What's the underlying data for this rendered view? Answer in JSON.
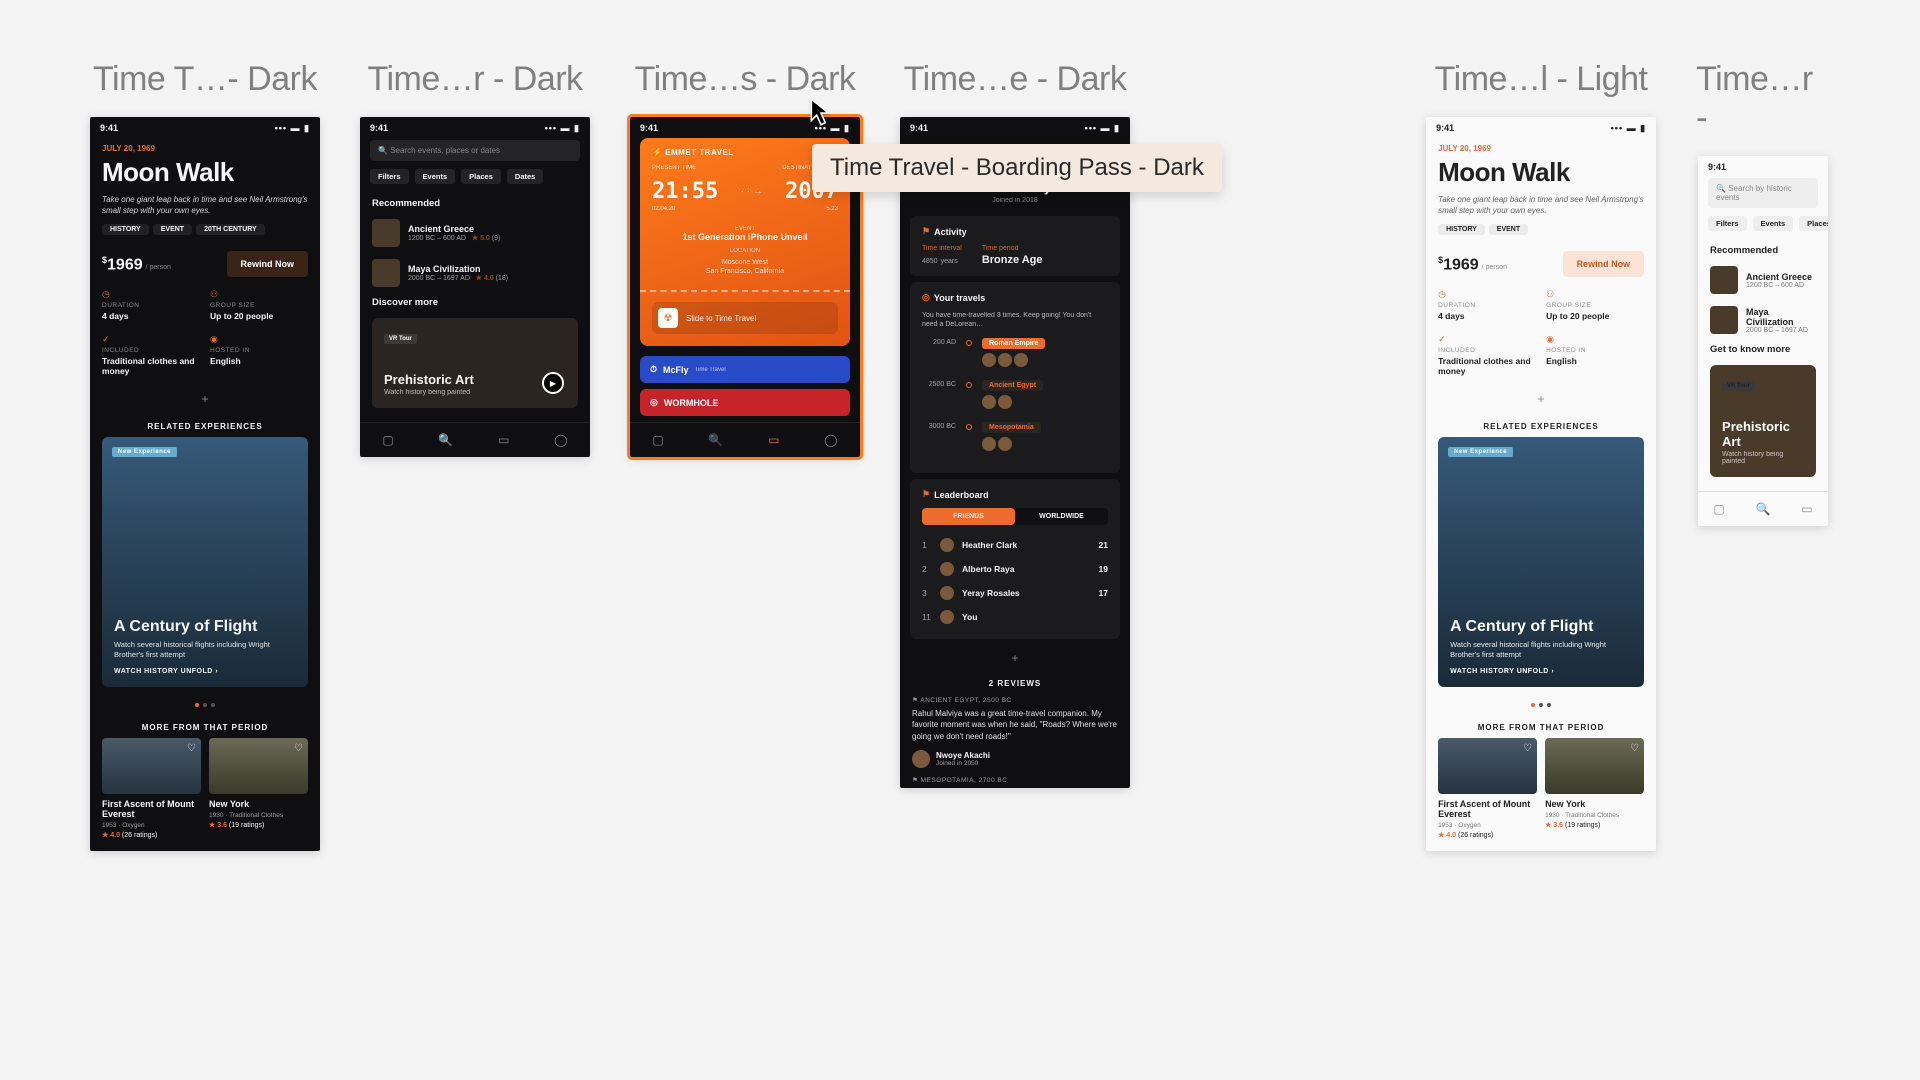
{
  "artboards": {
    "a1": "Time T…- Dark",
    "a2": "Time…r - Dark",
    "a3": "Time…s - Dark",
    "a4": "Time…e - Dark",
    "a5": "Time…l - Light",
    "a6": "Time…r -"
  },
  "tooltip": "Time Travel - Boarding Pass - Dark",
  "status_time": "9:41",
  "moon": {
    "date": "July 20, 1969",
    "title": "Moon Walk",
    "sub": "Take one giant leap back in time and see Neil Armstrong's small step with your own eyes.",
    "chips": [
      "History",
      "Event",
      "20th Century"
    ],
    "chips_light": [
      "History",
      "Event"
    ],
    "price": "1969",
    "per": "/ person",
    "rewind": "Rewind Now",
    "info": {
      "duration_l": "Duration",
      "duration_v": "4 days",
      "group_l": "Group size",
      "group_v": "Up to 20 people",
      "included_l": "Included",
      "included_v": "Traditional clothes and money",
      "hosted_l": "Hosted in",
      "hosted_v": "English"
    },
    "related": "Related Experiences",
    "flight": {
      "badge": "New Experience",
      "title": "A Century of Flight",
      "sub": "Watch several historical flights including Wright Brother's first attempt",
      "watch": "Watch History Unfold ›"
    },
    "more_head": "More From That Period",
    "cards": {
      "c1_title": "First Ascent of Mount Everest",
      "c1_meta": "1953 · Oxygen",
      "c1_rate": "4.0",
      "c1_rate_n": "(26 ratings)",
      "c2_title": "New York",
      "c2_meta": "1930 · Traditional Clothes",
      "c2_rate": "3.6",
      "c2_rate_n": "(19 ratings)"
    }
  },
  "search": {
    "placeholder_dark": "Search events, places or dates",
    "placeholder_light": "Search by historic events",
    "filters": [
      "Filters",
      "Events",
      "Places",
      "Dates"
    ],
    "filters_light": [
      "Filters",
      "Events",
      "Places"
    ],
    "rec_head": "Recommended",
    "rec": [
      {
        "title": "Ancient Greece",
        "sub": "1200 BC – 600 AD",
        "rate": "5.0",
        "n": "(9)"
      },
      {
        "title": "Maya Civilization",
        "sub": "2000 BC – 1697 AD",
        "rate": "4.0",
        "n": "(18)"
      }
    ],
    "discover_head_dark": "Discover more",
    "discover_head_light": "Get to know more",
    "discover": {
      "badge": "VR Tour",
      "title": "Prehistoric Art",
      "sub": "Watch history being painted"
    }
  },
  "pass": {
    "logo": "⚡ EMMET TRAVEL",
    "present_l": "Present time",
    "dest_l": "Destination time",
    "t1": "21:55",
    "t2": "2007",
    "d1": "02.04.20",
    "d2": "5.23",
    "event_l": "Event",
    "event": "1st Generation iPhone Unveil",
    "loc_l": "Location",
    "loc1": "Moscone West",
    "loc2": "San Francisco, California",
    "slide": "Slide to Time Travel",
    "promo1": "McFly",
    "promo1_tag": "Time Travel",
    "promo2": "WORMHOLE"
  },
  "profile": {
    "name": "Rahul Malviya",
    "joined": "Joined in 2018",
    "activity": "Activity",
    "act_items": {
      "interval_l": "Time interval",
      "interval_v": "4850",
      "interval_u": "years",
      "period_l": "Time period",
      "period_v": "Bronze Age"
    },
    "travels": "Your travels",
    "travels_note": "You have time-travelled 3 times. Keep going! You don't need a DeLorean…",
    "tl": [
      {
        "yr": "200 AD",
        "pill": "Roman Empire"
      },
      {
        "yr": "2500 BC",
        "pill": "Ancient Egypt"
      },
      {
        "yr": "3000 BC",
        "pill": "Mesopotamia"
      }
    ],
    "lb": "Leaderboard",
    "lb_tab1": "Friends",
    "lb_tab2": "Worldwide",
    "lb_rows": [
      {
        "r": "1",
        "name": "Heather Clark",
        "s": "21"
      },
      {
        "r": "2",
        "name": "Alberto Raya",
        "s": "19"
      },
      {
        "r": "3",
        "name": "Yeray Rosales",
        "s": "17"
      },
      {
        "r": "11",
        "name": "You",
        "s": ""
      }
    ],
    "reviews": "2 Reviews",
    "rev_meta": "Ancient Egypt, 2500 BC",
    "rev_body": "Rahul Malviya was a great time-travel companion. My favorite moment was when he said, \"Roads? Where we're going we don't need roads!\"",
    "reviewer": "Nwoye Akachi",
    "reviewer_sub": "Joined in 2050",
    "rev_meta2": "Mesopotamia, 2700 BC"
  }
}
